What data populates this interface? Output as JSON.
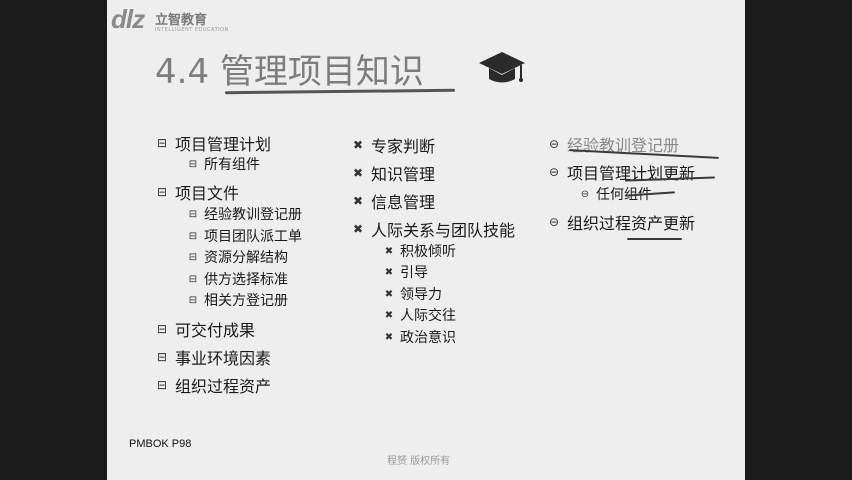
{
  "logo": {
    "mark": "dlz",
    "name": "立智教育",
    "sub": "INTELLIGENT EDUCATION"
  },
  "title": "4.4 管理项目知识",
  "col1": {
    "items": [
      {
        "text": "项目管理计划"
      },
      {
        "text": "所有组件"
      },
      {
        "text": "项目文件"
      },
      {
        "text": "经验教训登记册"
      },
      {
        "text": "项目团队派工单"
      },
      {
        "text": "资源分解结构"
      },
      {
        "text": "供方选择标准"
      },
      {
        "text": "相关方登记册"
      },
      {
        "text": "可交付成果"
      },
      {
        "text": "事业环境因素"
      },
      {
        "text": "组织过程资产"
      }
    ]
  },
  "col2": {
    "items": [
      {
        "text": "专家判断"
      },
      {
        "text": "知识管理"
      },
      {
        "text": "信息管理"
      },
      {
        "text": "人际关系与团队技能"
      },
      {
        "text": "积极倾听"
      },
      {
        "text": "引导"
      },
      {
        "text": "领导力"
      },
      {
        "text": "人际交往"
      },
      {
        "text": "政治意识"
      }
    ]
  },
  "col3": {
    "items": [
      {
        "text": "经验教训登记册"
      },
      {
        "text": "项目管理计划更新"
      },
      {
        "text": "任何组件"
      },
      {
        "text": "组织过程资产更新"
      }
    ]
  },
  "footer": "PMBOK P98",
  "watermark": "程赟 版权所有"
}
